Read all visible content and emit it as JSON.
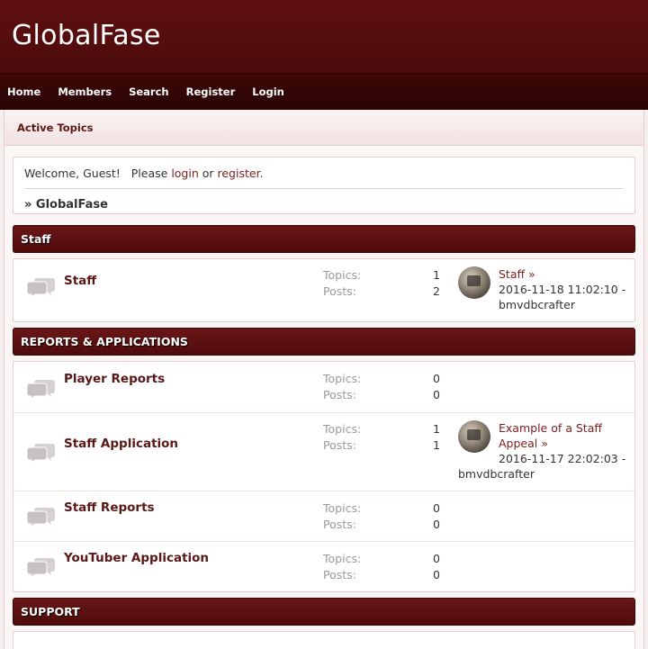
{
  "site": {
    "title": "GlobalFase"
  },
  "nav": {
    "items": [
      "Home",
      "Members",
      "Search",
      "Register",
      "Login"
    ]
  },
  "subnav": {
    "active_topics": "Active Topics"
  },
  "welcome": {
    "text_before": "Welcome, Guest!   Please ",
    "login_link": "login",
    "text_middle": " or ",
    "register_link": "register",
    "text_after": ".",
    "breadcrumb": "» GlobalFase"
  },
  "categories": [
    {
      "name": "Staff",
      "boards": [
        {
          "name": "Staff",
          "topics_label": "Topics:",
          "topics": "1",
          "posts_label": "Posts:",
          "posts": "2",
          "last_post": {
            "title": "Staff »",
            "date": "2016-11-18 11:02:10 -",
            "author": "bmvdbcrafter"
          }
        }
      ]
    },
    {
      "name": "REPORTS & APPLICATIONS",
      "boards": [
        {
          "name": "Player Reports",
          "topics_label": "Topics:",
          "topics": "0",
          "posts_label": "Posts:",
          "posts": "0"
        },
        {
          "name": "Staff Application",
          "topics_label": "Topics:",
          "topics": "1",
          "posts_label": "Posts:",
          "posts": "1",
          "last_post": {
            "title_line1": "Example of a Staff",
            "title_line2": "Appeal »",
            "date": "2016-11-17 22:02:03 -",
            "author": "bmvdbcrafter"
          }
        },
        {
          "name": "Staff Reports",
          "topics_label": "Topics:",
          "topics": "0",
          "posts_label": "Posts:",
          "posts": "0"
        },
        {
          "name": "YouTuber Application",
          "topics_label": "Topics:",
          "topics": "0",
          "posts_label": "Posts:",
          "posts": "0"
        }
      ]
    },
    {
      "name": "SUPPORT",
      "boards": []
    }
  ],
  "colors": {
    "header_bg": "#5e1010",
    "nav_bg": "#2a0404",
    "category_bg": "#5a1010",
    "link": "#7a1d1d",
    "page_bg": "#f6eeee"
  },
  "icons": {
    "board": "speech-bubbles-icon",
    "avatar": "user-avatar"
  }
}
